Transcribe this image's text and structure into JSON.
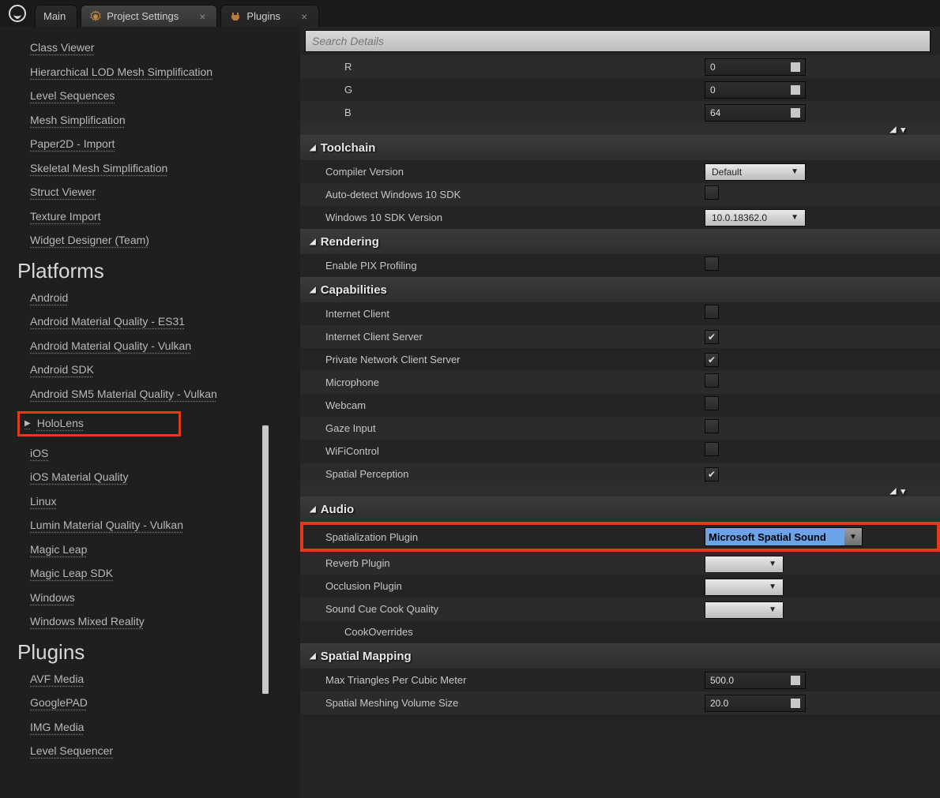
{
  "tabs": [
    {
      "label": "Main",
      "active": false,
      "closable": false
    },
    {
      "label": "Project Settings",
      "active": true,
      "closable": true
    },
    {
      "label": "Plugins",
      "active": false,
      "closable": true
    }
  ],
  "search": {
    "placeholder": "Search Details"
  },
  "sidebar": {
    "top_items": [
      "Class Viewer",
      "Hierarchical LOD Mesh Simplification",
      "Level Sequences",
      "Mesh Simplification",
      "Paper2D - Import",
      "Skeletal Mesh Simplification",
      "Struct Viewer",
      "Texture Import",
      "Widget Designer (Team)"
    ],
    "platforms_heading": "Platforms",
    "platforms": [
      "Android",
      "Android Material Quality - ES31",
      "Android Material Quality - Vulkan",
      "Android SDK",
      "Android SM5 Material Quality - Vulkan"
    ],
    "hololens": "HoloLens",
    "platforms2": [
      "iOS",
      "iOS Material Quality",
      "Linux",
      "Lumin Material Quality - Vulkan",
      "Magic Leap",
      "Magic Leap SDK",
      "Windows",
      "Windows Mixed Reality"
    ],
    "plugins_heading": "Plugins",
    "plugins": [
      "AVF Media",
      "GooglePAD",
      "IMG Media",
      "Level Sequencer"
    ]
  },
  "rgb": {
    "r_label": "R",
    "r_val": "0",
    "g_label": "G",
    "g_val": "0",
    "b_label": "B",
    "b_val": "64"
  },
  "toolchain": {
    "heading": "Toolchain",
    "compiler_label": "Compiler Version",
    "compiler_val": "Default",
    "autodetect_label": "Auto-detect Windows 10 SDK",
    "sdk_label": "Windows 10 SDK Version",
    "sdk_val": "10.0.18362.0"
  },
  "rendering": {
    "heading": "Rendering",
    "pix_label": "Enable PIX Profiling"
  },
  "capabilities": {
    "heading": "Capabilities",
    "items": [
      {
        "label": "Internet Client",
        "on": false
      },
      {
        "label": "Internet Client Server",
        "on": true
      },
      {
        "label": "Private Network Client Server",
        "on": true
      },
      {
        "label": "Microphone",
        "on": false
      },
      {
        "label": "Webcam",
        "on": false
      },
      {
        "label": "Gaze Input",
        "on": false
      },
      {
        "label": "WiFiControl",
        "on": false
      },
      {
        "label": "Spatial Perception",
        "on": true
      }
    ]
  },
  "audio": {
    "heading": "Audio",
    "spatialization_label": "Spatialization Plugin",
    "spatialization_val": "Microsoft Spatial Sound",
    "reverb_label": "Reverb Plugin",
    "occlusion_label": "Occlusion Plugin",
    "soundcue_label": "Sound Cue Cook Quality",
    "cook_label": "CookOverrides"
  },
  "spatial_mapping": {
    "heading": "Spatial Mapping",
    "max_tri_label": "Max Triangles Per Cubic Meter",
    "max_tri_val": "500.0",
    "vol_label": "Spatial Meshing Volume Size",
    "vol_val": "20.0"
  }
}
